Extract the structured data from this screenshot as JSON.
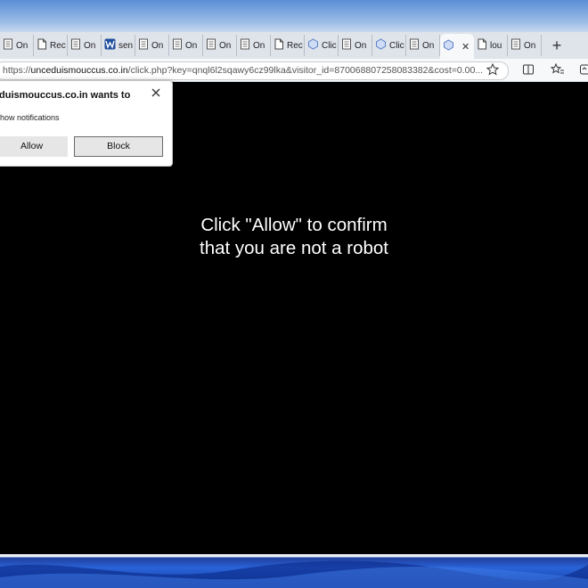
{
  "tabs": [
    {
      "label": "On",
      "icon": "document-icon"
    },
    {
      "label": "Rec",
      "icon": "page-icon"
    },
    {
      "label": "On",
      "icon": "document-icon"
    },
    {
      "label": "sen",
      "icon": "w-logo-icon"
    },
    {
      "label": "On",
      "icon": "document-icon"
    },
    {
      "label": "On",
      "icon": "document-icon"
    },
    {
      "label": "On",
      "icon": "document-icon"
    },
    {
      "label": "On",
      "icon": "document-icon"
    },
    {
      "label": "Rec",
      "icon": "page-icon"
    },
    {
      "label": "Clic",
      "icon": "puzzle-icon"
    },
    {
      "label": "On",
      "icon": "document-icon"
    },
    {
      "label": "Clic",
      "icon": "puzzle-icon"
    },
    {
      "label": "On",
      "icon": "document-icon"
    },
    {
      "label": "",
      "icon": "puzzle-icon",
      "active": true
    },
    {
      "label": "lou",
      "icon": "page-icon"
    },
    {
      "label": "On",
      "icon": "document-icon"
    }
  ],
  "address": {
    "prefix": "https://",
    "host": "unceduismouccus.co.in",
    "path": "/click.php?key=qnql6l2sqawy6cz99lka&visitor_id=870068807258083382&cost=0.00..."
  },
  "permission_popup": {
    "title": "duismouccus.co.in wants to",
    "description": "how notifications",
    "allow_label": "Allow",
    "block_label": "Block"
  },
  "page": {
    "line1": "Click \"Allow\" to confirm",
    "line2": "that you are not a robot"
  },
  "colors": {
    "page_background": "#000000",
    "text": "#ffffff",
    "tabstrip": "#dfe3ea"
  }
}
